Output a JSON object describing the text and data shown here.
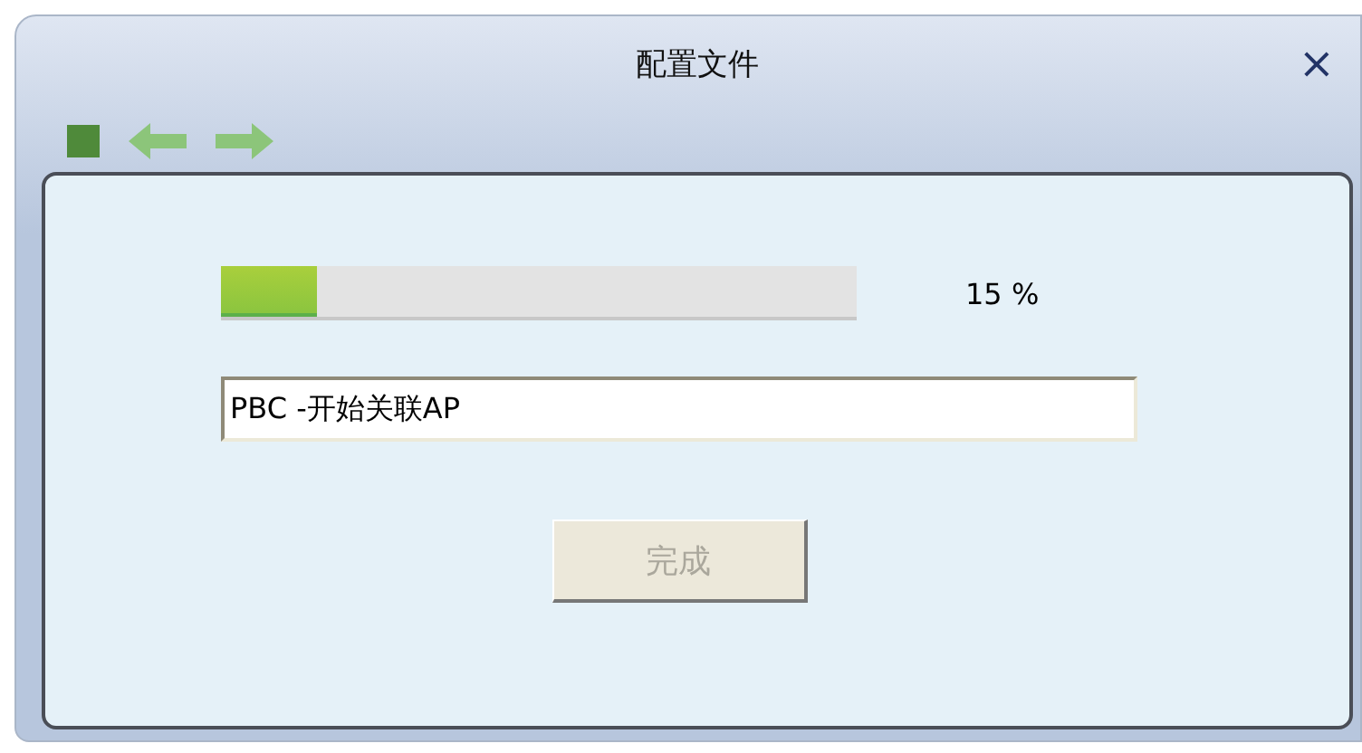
{
  "window": {
    "title": "配置文件",
    "close": "×"
  },
  "toolbar": [
    {
      "kind": "stop"
    },
    {
      "kind": "back"
    },
    {
      "kind": "forward"
    }
  ],
  "progress": {
    "level": 0.15,
    "reading": "15 %"
  },
  "status_field": {
    "value": "PBC -开始关联AP"
  },
  "button": {
    "label": "完成",
    "disabled": true
  }
}
